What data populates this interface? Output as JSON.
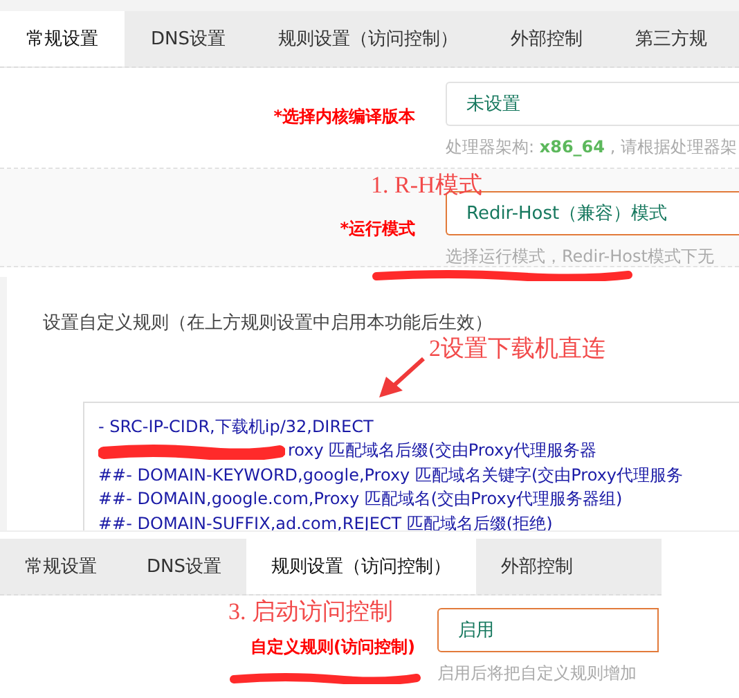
{
  "top_panel": {
    "tabs": [
      {
        "label": "常规设置",
        "selected": true
      },
      {
        "label": "DNS设置",
        "selected": false
      },
      {
        "label": "规则设置（访问控制）",
        "selected": false
      },
      {
        "label": "外部控制",
        "selected": false
      },
      {
        "label": "第三方规",
        "selected": false
      }
    ],
    "rows": [
      {
        "label": "*选择内核编译版本",
        "value": "未设置",
        "focused": false,
        "shaded": false,
        "hint": "处理器架构: **x86_64** , 请根据处理器架"
      },
      {
        "label": "*运行模式",
        "value": "Redir-Host（兼容）模式",
        "focused": true,
        "shaded": true,
        "hint": "选择运行模式，Redir-Host模式下无",
        "annotation": "1. R-H模式"
      }
    ]
  },
  "rules_panel": {
    "label": "设置自定义规则（在上方规则设置中启用本功能后生效）",
    "annotation": "2设置下载机直连",
    "lines": [
      {
        "text": "- SRC-IP-CIDR,下载机ip/32,DIRECT",
        "redacted": false
      },
      {
        "text": "roxy 匹配域名后缀(交由Proxy代理服务器",
        "redacted": true
      },
      {
        "text": "##- DOMAIN-KEYWORD,google,Proxy 匹配域名关键字(交由Proxy代理服务",
        "redacted": false
      },
      {
        "text": "##- DOMAIN,google.com,Proxy 匹配域名(交由Proxy代理服务器组)",
        "redacted": false
      },
      {
        "text": "##- DOMAIN-SUFFIX,ad.com,REJECT 匹配域名后缀(拒绝)",
        "redacted": false
      }
    ]
  },
  "bottom_panel": {
    "tabs": [
      {
        "label": "常规设置",
        "selected": false
      },
      {
        "label": "DNS设置",
        "selected": false
      },
      {
        "label": "规则设置（访问控制）",
        "selected": true
      },
      {
        "label": "外部控制",
        "selected": false
      }
    ],
    "rows": [
      {
        "label": "自定义规则(访问控制)",
        "value": "启用",
        "focused": true,
        "hint": "启用后将把自定义规则增加",
        "annotation": "3. 启动访问控制"
      }
    ]
  }
}
